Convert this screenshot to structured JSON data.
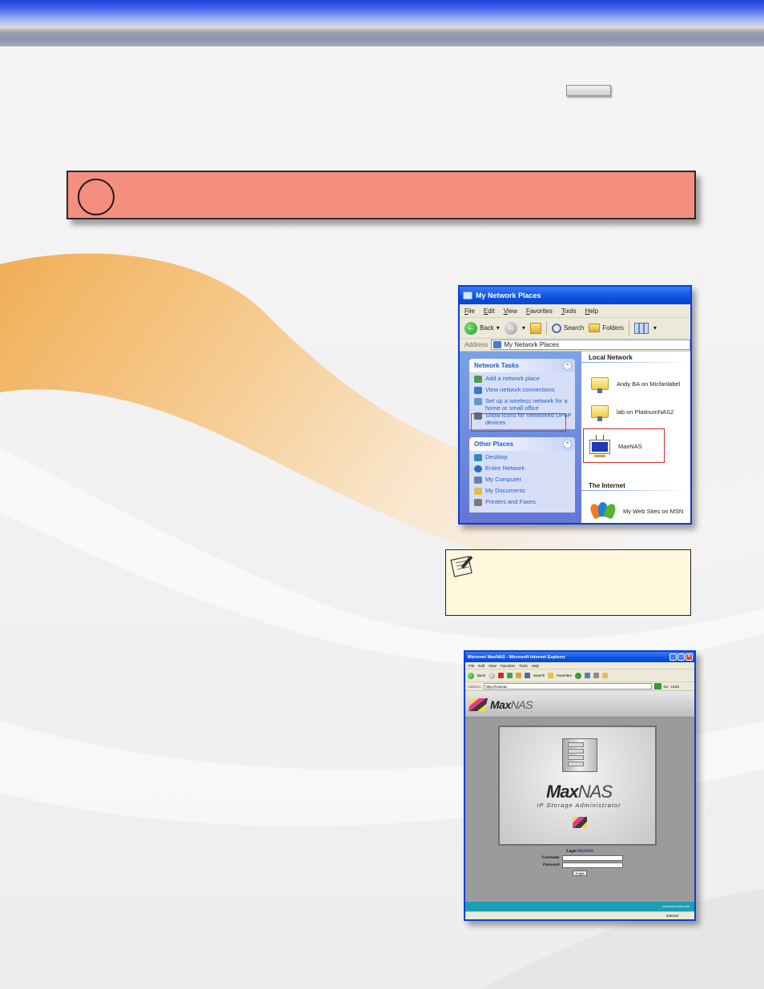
{
  "xp_window": {
    "title": "My Network Places",
    "menu": [
      "File",
      "Edit",
      "View",
      "Favorites",
      "Tools",
      "Help"
    ],
    "toolbar": {
      "back": "Back",
      "search": "Search",
      "folders": "Folders"
    },
    "address_label": "Address",
    "address_value": "My Network Places",
    "network_tasks": {
      "title": "Network Tasks",
      "items": [
        "Add a network place",
        "View network connections",
        "Set up a wireless network for a home or small office",
        "Show icons for networked UPnP devices"
      ]
    },
    "other_places": {
      "title": "Other Places",
      "items": [
        "Desktop",
        "Entire Network",
        "My Computer",
        "My Documents",
        "Printers and Faxes"
      ]
    },
    "local_network": {
      "title": "Local Network",
      "items": [
        "Andy BA on Micfanlabel",
        "lab on PlatinumNAS2",
        "MaxNAS"
      ]
    },
    "internet": {
      "title": "The Internet",
      "items": [
        "My Web Sites on MSN"
      ]
    }
  },
  "ie_window": {
    "title": "Micronet MaxNAS - Microsoft Internet Explorer",
    "menu": [
      "File",
      "Edit",
      "View",
      "Favorites",
      "Tools",
      "Help"
    ],
    "toolbar": {
      "back": "Back",
      "search": "Search",
      "favorites": "Favorites"
    },
    "address_label": "Address",
    "address_value": "http://maxnas",
    "go": "Go",
    "links": "Links",
    "header_logo": {
      "max": "Max",
      "nas": "NAS"
    },
    "panel_brand": {
      "max": "Max",
      "nas": "NAS"
    },
    "panel_subtitle": "IP Storage Administrator",
    "login": {
      "title_prefix": "Login ",
      "title_link": "MaxNAS",
      "username_label": "Username",
      "password_label": "Password",
      "button": "Login"
    },
    "footer": "www.micronet.com",
    "status": "Internet"
  }
}
